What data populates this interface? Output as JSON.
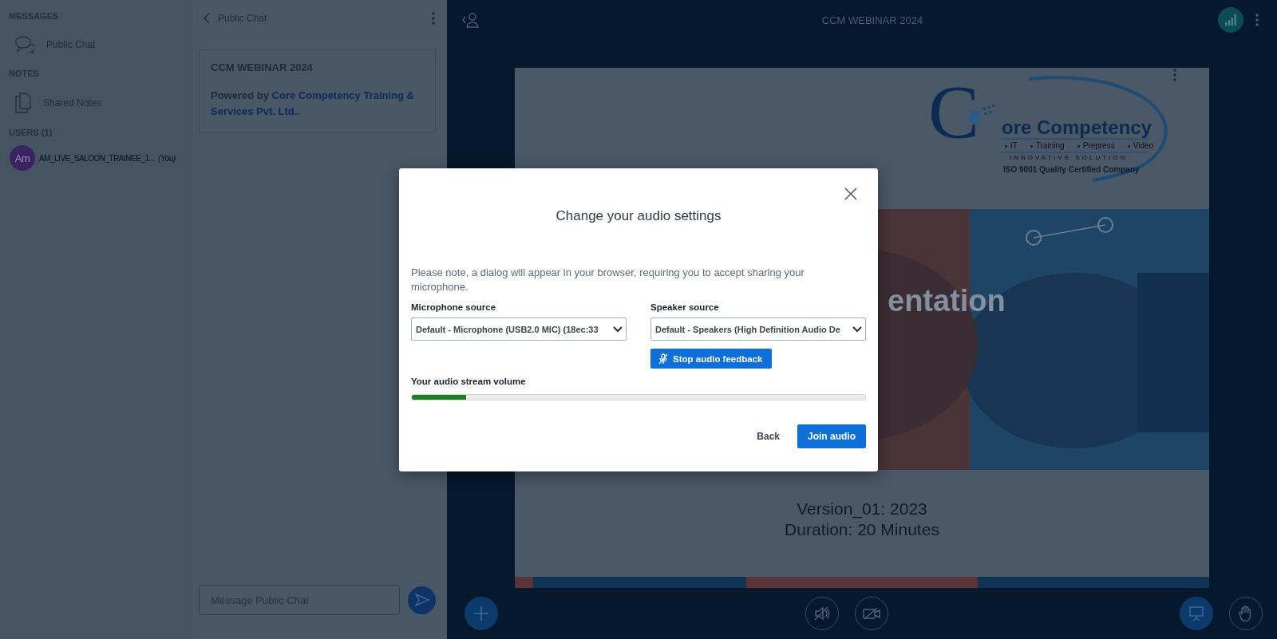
{
  "sidebar": {
    "sections": [
      {
        "title": "MESSAGES",
        "items": [
          {
            "kind": "chat",
            "label": "Public Chat"
          }
        ]
      },
      {
        "title": "NOTES",
        "items": [
          {
            "kind": "notes",
            "label": "Shared Notes"
          }
        ]
      },
      {
        "title": "USERS (1)",
        "items": [
          {
            "kind": "user",
            "avatar": "Am",
            "label": "AM_LIVE_SALOON_TRAINEE_1...",
            "tag": "(You)"
          }
        ]
      }
    ]
  },
  "chat": {
    "title": "Public Chat",
    "welcome": {
      "title": "CCM WEBINAR 2024",
      "prefix": "Powered by ",
      "link_lines": [
        "Core Competency Training &",
        "Services Pvt. Ltd."
      ],
      "suffix": "."
    },
    "input": {
      "placeholder": "Message Public Chat"
    }
  },
  "main": {
    "title": "CCM WEBINAR 2024"
  },
  "slide": {
    "logo": {
      "initial": "C",
      "brand": "ore Competency",
      "services": [
        "IT",
        "Training",
        "Prepress",
        "Video"
      ],
      "tagline": "INNOVATIVE SOLUTION",
      "certification": "ISO 9001 Quality Certified Company"
    },
    "banner_text": "entation",
    "lines": [
      "Version_01: 2023",
      "Duration: 20 Minutes"
    ]
  },
  "dialog": {
    "title": "Change your audio settings",
    "note": "Please note, a dialog will appear in your browser, requiring you to accept sharing your microphone.",
    "microphone": {
      "label": "Microphone source",
      "value": "Default - Microphone (USB2.0 MIC) (18ec:33"
    },
    "speaker": {
      "label": "Speaker source",
      "value": "Default - Speakers (High Definition Audio De"
    },
    "feedback_button": "Stop audio feedback",
    "volume": {
      "label": "Your audio stream volume",
      "level": 0.12
    },
    "buttons": [
      {
        "kind": "secondary",
        "label": "Back"
      },
      {
        "kind": "primary",
        "label": "Join audio"
      }
    ]
  }
}
